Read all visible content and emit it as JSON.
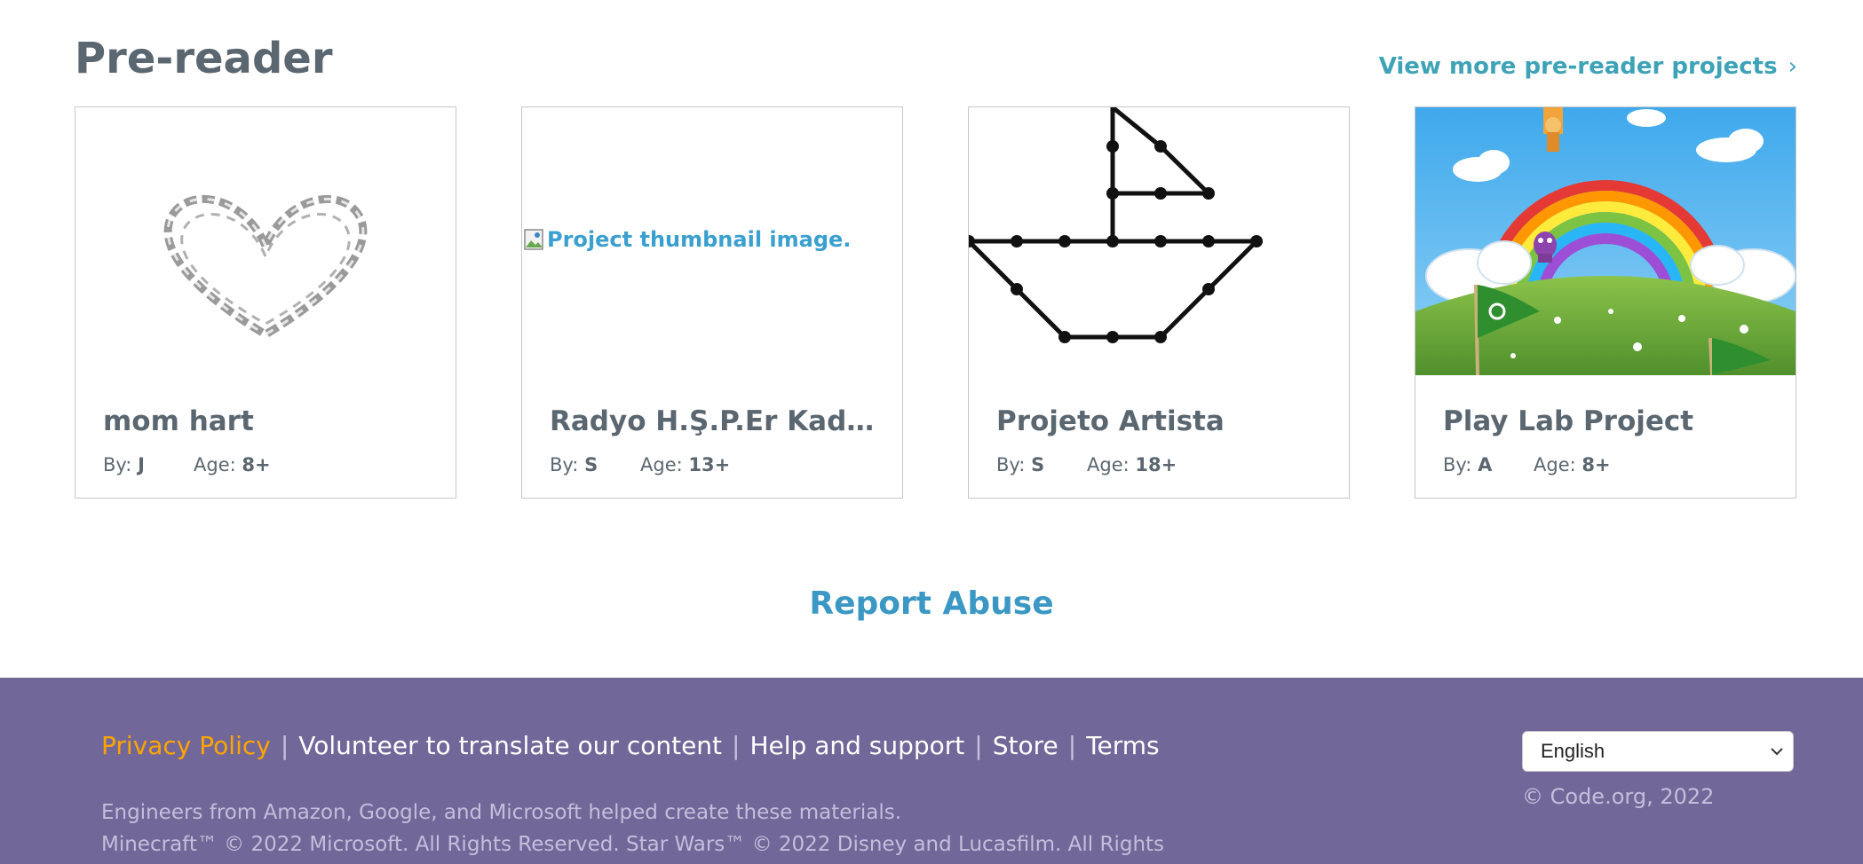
{
  "section": {
    "title": "Pre-reader",
    "view_more": "View more pre-reader projects",
    "view_more_icon": "chevron-right-icon"
  },
  "cards": [
    {
      "title": "mom hart",
      "by_label": "By:",
      "by": "J",
      "age_label": "Age:",
      "age": "8+",
      "thumb": "heart-drawing"
    },
    {
      "title": "Radyo H.Ş.P.Er Kadir ...",
      "by_label": "By:",
      "by": "S",
      "age_label": "Age:",
      "age": "13+",
      "thumb": "broken-image",
      "alt": "Project thumbnail image."
    },
    {
      "title": "Projeto Artista",
      "by_label": "By:",
      "by": "S",
      "age_label": "Age:",
      "age": "18+",
      "thumb": "boat-drawing"
    },
    {
      "title": "Play Lab Project",
      "by_label": "By:",
      "by": "A",
      "age_label": "Age:",
      "age": "8+",
      "thumb": "rainbow-scene"
    }
  ],
  "report_abuse": "Report Abuse",
  "footer": {
    "links": [
      "Privacy Policy",
      "Volunteer to translate our content",
      "Help and support",
      "Store",
      "Terms"
    ],
    "separator": "|",
    "credits_line1": "Engineers from Amazon, Google, and Microsoft helped create these materials.",
    "credits_line2": "Minecraft™ © 2022 Microsoft. All Rights Reserved. Star Wars™ © 2022 Disney and Lucasfilm. All Rights",
    "language": "English",
    "copyright": "© Code.org, 2022"
  },
  "colors": {
    "title": "#5b6770",
    "link": "#3ea3b6",
    "report": "#3b98c4",
    "footer_bg": "#726799",
    "privacy": "#ffa400"
  }
}
